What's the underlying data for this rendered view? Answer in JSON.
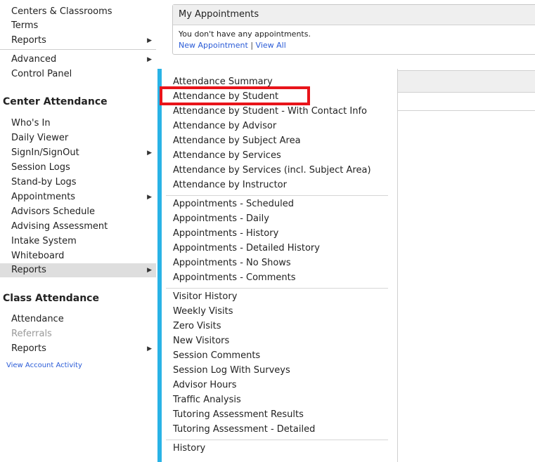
{
  "sidebar": {
    "top_items": [
      {
        "label": "Centers & Classrooms",
        "has_submenu": false
      },
      {
        "label": "Terms",
        "has_submenu": false
      },
      {
        "label": "Reports",
        "has_submenu": true
      }
    ],
    "admin_items": [
      {
        "label": "Advanced",
        "has_submenu": true
      },
      {
        "label": "Control Panel",
        "has_submenu": false
      }
    ],
    "center_attendance": {
      "heading": "Center Attendance",
      "items": [
        {
          "label": "Who's In",
          "has_submenu": false
        },
        {
          "label": "Daily Viewer",
          "has_submenu": false
        },
        {
          "label": "SignIn/SignOut",
          "has_submenu": true
        },
        {
          "label": "Session Logs",
          "has_submenu": false
        },
        {
          "label": "Stand-by Logs",
          "has_submenu": false
        },
        {
          "label": "Appointments",
          "has_submenu": true
        },
        {
          "label": "Advisors Schedule",
          "has_submenu": false
        },
        {
          "label": "Advising Assessment",
          "has_submenu": false
        },
        {
          "label": "Intake System",
          "has_submenu": false
        },
        {
          "label": "Whiteboard",
          "has_submenu": false
        },
        {
          "label": "Reports",
          "has_submenu": true,
          "active": true
        }
      ]
    },
    "class_attendance": {
      "heading": "Class Attendance",
      "items": [
        {
          "label": "Attendance",
          "has_submenu": false
        },
        {
          "label": "Referrals",
          "has_submenu": false,
          "disabled": true
        },
        {
          "label": "Reports",
          "has_submenu": true
        }
      ]
    },
    "account_link": "View Account Activity",
    "arrow_glyph": "▶"
  },
  "appointments_panel": {
    "title": "My Appointments",
    "message": "You don't have any appointments.",
    "new_link": "New Appointment",
    "separator": "|",
    "view_all_link": "View All"
  },
  "reports_menu": {
    "highlighted_item": "Attendance by Student",
    "highlight_color": "#e8141a",
    "accent_color": "#29b3e6",
    "groups": [
      [
        "Attendance Summary",
        "Attendance by Student",
        "Attendance by Student - With Contact Info",
        "Attendance by Advisor",
        "Attendance by Subject Area",
        "Attendance by Services",
        "Attendance by Services (incl. Subject Area)",
        "Attendance by Instructor"
      ],
      [
        "Appointments - Scheduled",
        "Appointments - Daily",
        "Appointments - History",
        "Appointments - Detailed History",
        "Appointments - No Shows",
        "Appointments - Comments"
      ],
      [
        "Visitor History",
        "Weekly Visits",
        "Zero Visits",
        "New Visitors",
        "Session Comments",
        "Session Log With Surveys",
        "Advisor Hours",
        "Traffic Analysis",
        "Tutoring Assessment Results",
        "Tutoring Assessment - Detailed"
      ],
      [
        "History"
      ]
    ]
  }
}
